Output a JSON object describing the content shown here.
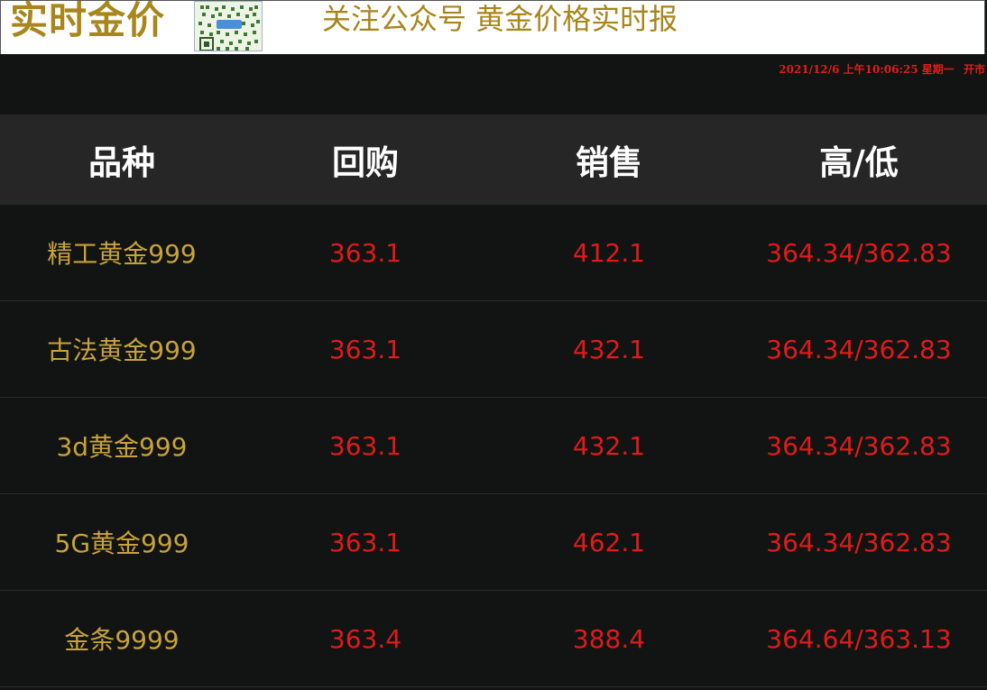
{
  "header": {
    "brand": "实时金价",
    "slogan": "关注公众号 黄金价格实时报"
  },
  "status": {
    "datetime": "2021/12/6 上午10:06:25 星期一",
    "market": "开市"
  },
  "table": {
    "columns": [
      "品种",
      "回购",
      "销售",
      "高/低"
    ],
    "rows": [
      {
        "name": "精工黄金999",
        "buyback": "363.1",
        "sell": "412.1",
        "high_low": "364.34/362.83"
      },
      {
        "name": "古法黄金999",
        "buyback": "363.1",
        "sell": "432.1",
        "high_low": "364.34/362.83"
      },
      {
        "name": "3d黄金999",
        "buyback": "363.1",
        "sell": "432.1",
        "high_low": "364.34/362.83"
      },
      {
        "name": "5G黄金999",
        "buyback": "363.1",
        "sell": "462.1",
        "high_low": "364.34/362.83"
      },
      {
        "name": "金条9999",
        "buyback": "363.4",
        "sell": "388.4",
        "high_low": "364.64/363.13"
      }
    ]
  },
  "colors": {
    "gold": "#a8861c",
    "name_text": "#c9a23a",
    "price_red": "#e01a1a",
    "background": "#111412",
    "header_row": "#262626"
  }
}
